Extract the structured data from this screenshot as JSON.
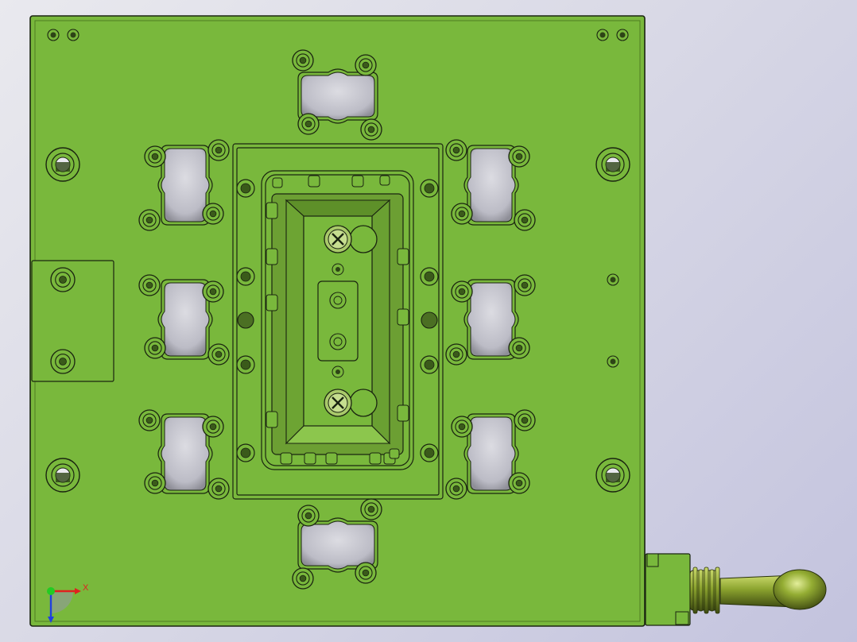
{
  "view": {
    "background_top": "#e9e9ee",
    "background_bottom": "#c3c3de"
  },
  "colors": {
    "plate": "#79b83c",
    "plate_edge": "#4e7d22",
    "line": "#1a2410",
    "cavity": "#c9c9d0",
    "cavity_dark": "#8e8e97",
    "pocket_wall": "#6c9f33",
    "handle": "#8aa22e",
    "handle_dark": "#52621a",
    "axis_x": "#e02020",
    "axis_y": "#2040e0",
    "origin": "#22cc22"
  },
  "triad": {
    "x_label": "X"
  },
  "icons": {
    "origin": "coordinate-triad-icon",
    "screw": "phillips-screw-icon",
    "bolt": "socket-bolt-icon",
    "handle": "ball-knob-handle-icon"
  }
}
